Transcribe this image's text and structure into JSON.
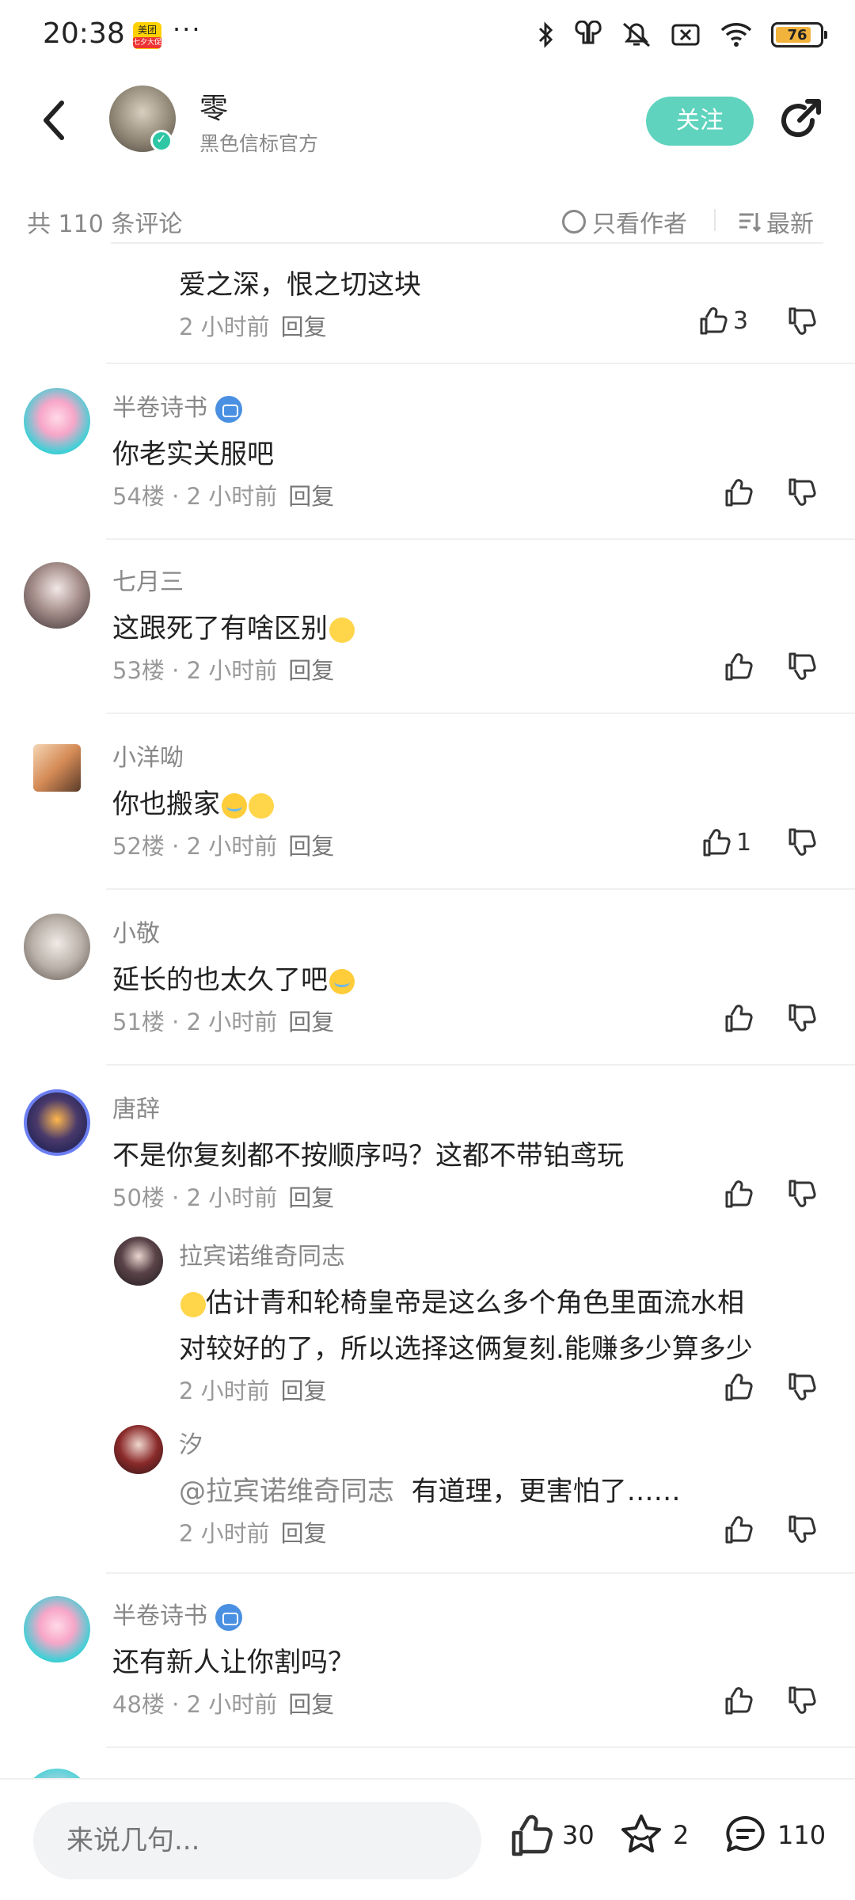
{
  "status_bar": {
    "time": "20:38",
    "app_badge": "美团",
    "app_badge_sub": "七夕大促",
    "more": "···",
    "battery": "76",
    "icons": [
      "bluetooth-icon",
      "earbuds-icon",
      "mute-icon",
      "sim-off-icon",
      "wifi-icon",
      "battery-icon"
    ]
  },
  "header": {
    "author_name": "零",
    "author_subtitle": "黑色信标官方",
    "follow_label": "关注",
    "accent_color": "#5fd3be"
  },
  "subheader": {
    "comment_count": "共 110 条评论",
    "only_author": "只看作者",
    "sort": "最新"
  },
  "comments": [
    {
      "text": "爱之深，恨之切这块",
      "time": "2 小时前",
      "reply": "回复",
      "likes": "3"
    },
    {
      "user": "半卷诗书",
      "text": "你老实关服吧",
      "floor": "54楼",
      "time": "2 小时前",
      "reply": "回复"
    },
    {
      "user": "七月三",
      "text": "这跟死了有啥区别",
      "floor": "53楼",
      "time": "2 小时前",
      "reply": "回复"
    },
    {
      "user": "小洋呦",
      "text": "你也搬家",
      "floor": "52楼",
      "time": "2 小时前",
      "reply": "回复",
      "likes": "1"
    },
    {
      "user": "小敬",
      "text": "延长的也太久了吧",
      "floor": "51楼",
      "time": "2 小时前",
      "reply": "回复"
    },
    {
      "user": "唐辞",
      "text": "不是你复刻都不按顺序吗？这都不带铂鸢玩",
      "floor": "50楼",
      "time": "2 小时前",
      "reply": "回复",
      "replies": [
        {
          "user": "拉宾诺维奇同志",
          "text_line1": "估计青和轮椅皇帝是这么多个角色里面流水相",
          "text_line2": "对较好的了，所以选择这俩复刻.能赚多少算多少",
          "time": "2 小时前",
          "reply": "回复"
        },
        {
          "user": "汐",
          "mention": "@拉宾诺维奇同志",
          "text": "有道理，更害怕了……",
          "time": "2 小时前",
          "reply": "回复"
        }
      ]
    },
    {
      "user": "半卷诗书",
      "text": "还有新人让你割吗？",
      "floor": "48楼",
      "time": "2 小时前",
      "reply": "回复"
    }
  ],
  "bottom_bar": {
    "input_placeholder": "来说几句...",
    "likes": "30",
    "favorites": "2",
    "comments": "110"
  }
}
